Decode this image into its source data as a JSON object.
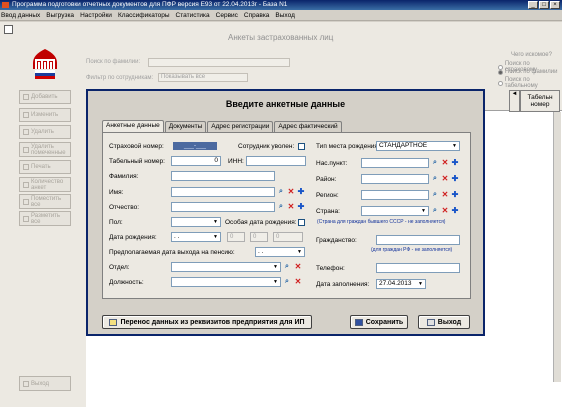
{
  "window": {
    "title": "Программа подготовки отчетных документов для ПФР версия Е93 от 22.04.2013г - База N1"
  },
  "menu": [
    "Ввод данных",
    "Выгрузка",
    "Настройки",
    "Классификаторы",
    "Статистика",
    "Сервис",
    "Справка",
    "Выход"
  ],
  "sidebar": [
    {
      "label": "Добавить"
    },
    {
      "label": "Изменить"
    },
    {
      "label": "Удалить"
    },
    {
      "label": "Удалить помеченные"
    },
    {
      "label": "Печать"
    },
    {
      "label": "Количество анкет"
    },
    {
      "label": "Поместить все"
    },
    {
      "label": "Разметить все"
    }
  ],
  "sidebar_exit": "Выход",
  "main": {
    "title": "Анкеты застрахованных лиц",
    "search_surname_label": "Поиск по фамилии:",
    "filter_label": "Фильтр по сотрудникам:",
    "filter_value": "Показывать все",
    "search_group": {
      "title": "Чего искомое?",
      "options": [
        "Поиск по страховому",
        "Поиск по фамилии",
        "Поиск по табельному"
      ],
      "selected": 1
    },
    "grid_header_tab": "Табельн номер"
  },
  "dialog": {
    "title": "Введите анкетные данные",
    "tabs": [
      "Анкетные данные",
      "Документы",
      "Адрес регистрации",
      "Адрес фактический"
    ],
    "active_tab": 0,
    "left": {
      "snils_label": "Страховой номер:",
      "snils_value": "___-___",
      "fired_label": "Сотрудник уволен:",
      "tab_no_label": "Табельный номер:",
      "tab_no_value": "0",
      "inn_label": "ИНН:",
      "surname_label": "Фамилия:",
      "name_label": "Имя:",
      "patronymic_label": "Отчество:",
      "sex_label": "Пол:",
      "special_date_label": "Особая дата рождения:",
      "birth_label": "Дата рождения:",
      "birth_value": ". .",
      "birth_spins": [
        "0",
        "0",
        "0"
      ],
      "pension_label": "Предполагаемая дата выхода на пенсию:",
      "pension_value": ". .",
      "dept_label": "Отдел:",
      "position_label": "Должность:"
    },
    "right": {
      "birthplace_type_label": "Тип места рождения:",
      "birthplace_type_value": "СТАНДАРТНОЕ",
      "town_label": "Нас.пункт:",
      "district_label": "Район:",
      "region_label": "Регион:",
      "country_label": "Страна:",
      "country_note": "(Страна для граждан бывшего СССР - не заполняется)",
      "citizenship_label": "Гражданство:",
      "citizenship_note": "(для граждан РФ - не заполняется)",
      "phone_label": "Телефон:",
      "filled_date_label": "Дата заполнения:",
      "filled_date_value": "27.04.2013"
    },
    "buttons": {
      "transfer": "Перенос данных из реквизитов предприятия для ИП",
      "save": "Сохранить",
      "exit": "Выход"
    }
  }
}
